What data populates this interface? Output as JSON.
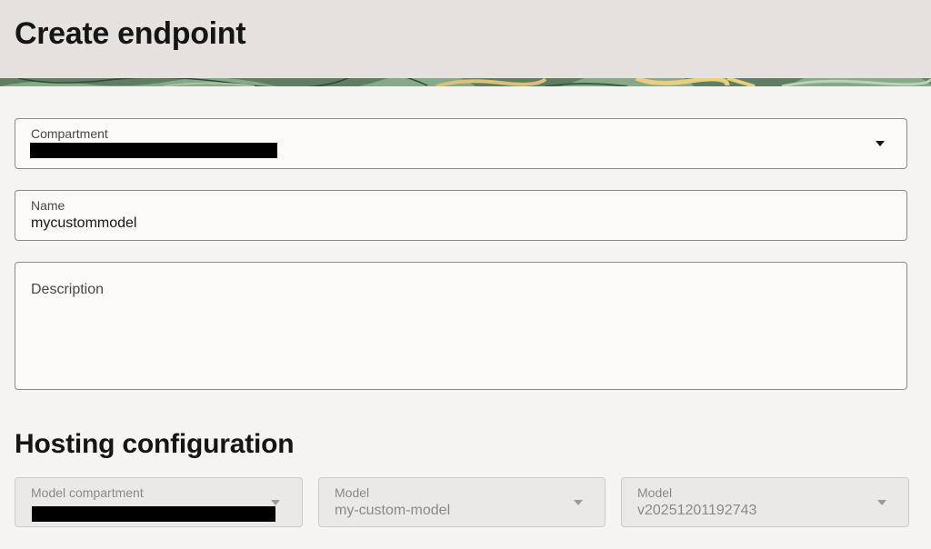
{
  "header": {
    "title": "Create endpoint"
  },
  "form": {
    "compartment": {
      "label": "Compartment",
      "value_redacted": true
    },
    "name": {
      "label": "Name",
      "value": "mycustommodel"
    },
    "description": {
      "label": "Description",
      "value": ""
    }
  },
  "hosting": {
    "title": "Hosting configuration",
    "model_compartment": {
      "label": "Model compartment",
      "value_redacted": true,
      "disabled": true
    },
    "model": {
      "label": "Model",
      "value": "my-custom-model",
      "disabled": true
    },
    "model_version": {
      "label": "Model",
      "value": "v20251201192743",
      "disabled": true
    }
  },
  "icons": {
    "dropdown": "chevron-down-icon"
  },
  "colors": {
    "header_bg": "#e4e1de",
    "page_bg": "#f5f4f2",
    "field_border": "#8f8a85",
    "disabled_bg": "#ebe9e7"
  }
}
